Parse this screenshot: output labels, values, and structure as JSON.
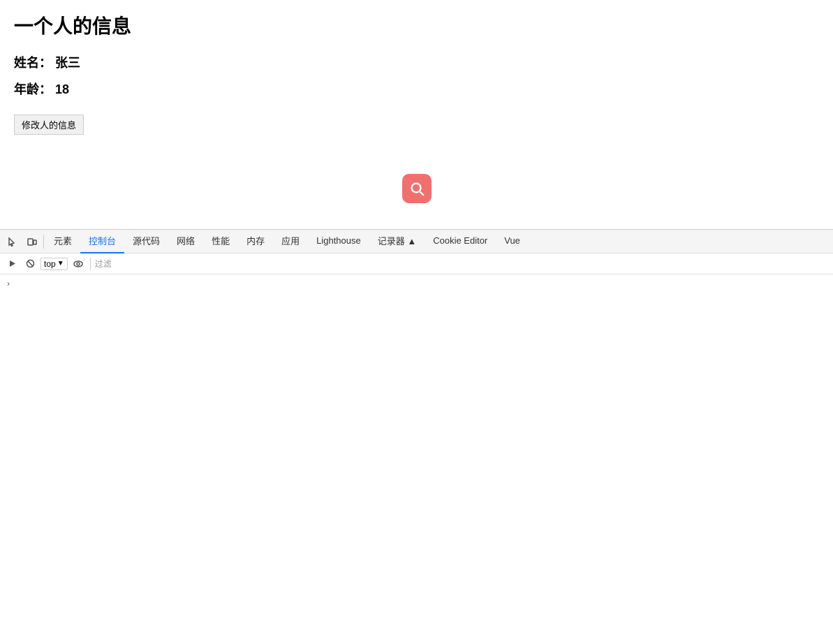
{
  "page": {
    "title": "一个人的信息",
    "name_label": "姓名：",
    "name_value": "张三",
    "age_label": "年龄：",
    "age_value": "18",
    "edit_button": "修改人的信息"
  },
  "devtools": {
    "tabs": [
      {
        "id": "elements",
        "label": "元素",
        "active": false
      },
      {
        "id": "console",
        "label": "控制台",
        "active": true
      },
      {
        "id": "sources",
        "label": "源代码",
        "active": false
      },
      {
        "id": "network",
        "label": "网络",
        "active": false
      },
      {
        "id": "performance",
        "label": "性能",
        "active": false
      },
      {
        "id": "memory",
        "label": "内存",
        "active": false
      },
      {
        "id": "application",
        "label": "应用",
        "active": false
      },
      {
        "id": "lighthouse",
        "label": "Lighthouse",
        "active": false
      },
      {
        "id": "recorder",
        "label": "记录器 ▲",
        "active": false
      },
      {
        "id": "cookie-editor",
        "label": "Cookie Editor",
        "active": false
      },
      {
        "id": "vue",
        "label": "Vue",
        "active": false
      }
    ],
    "console_toolbar": {
      "top_label": "top",
      "filter_placeholder": "过滤"
    }
  }
}
